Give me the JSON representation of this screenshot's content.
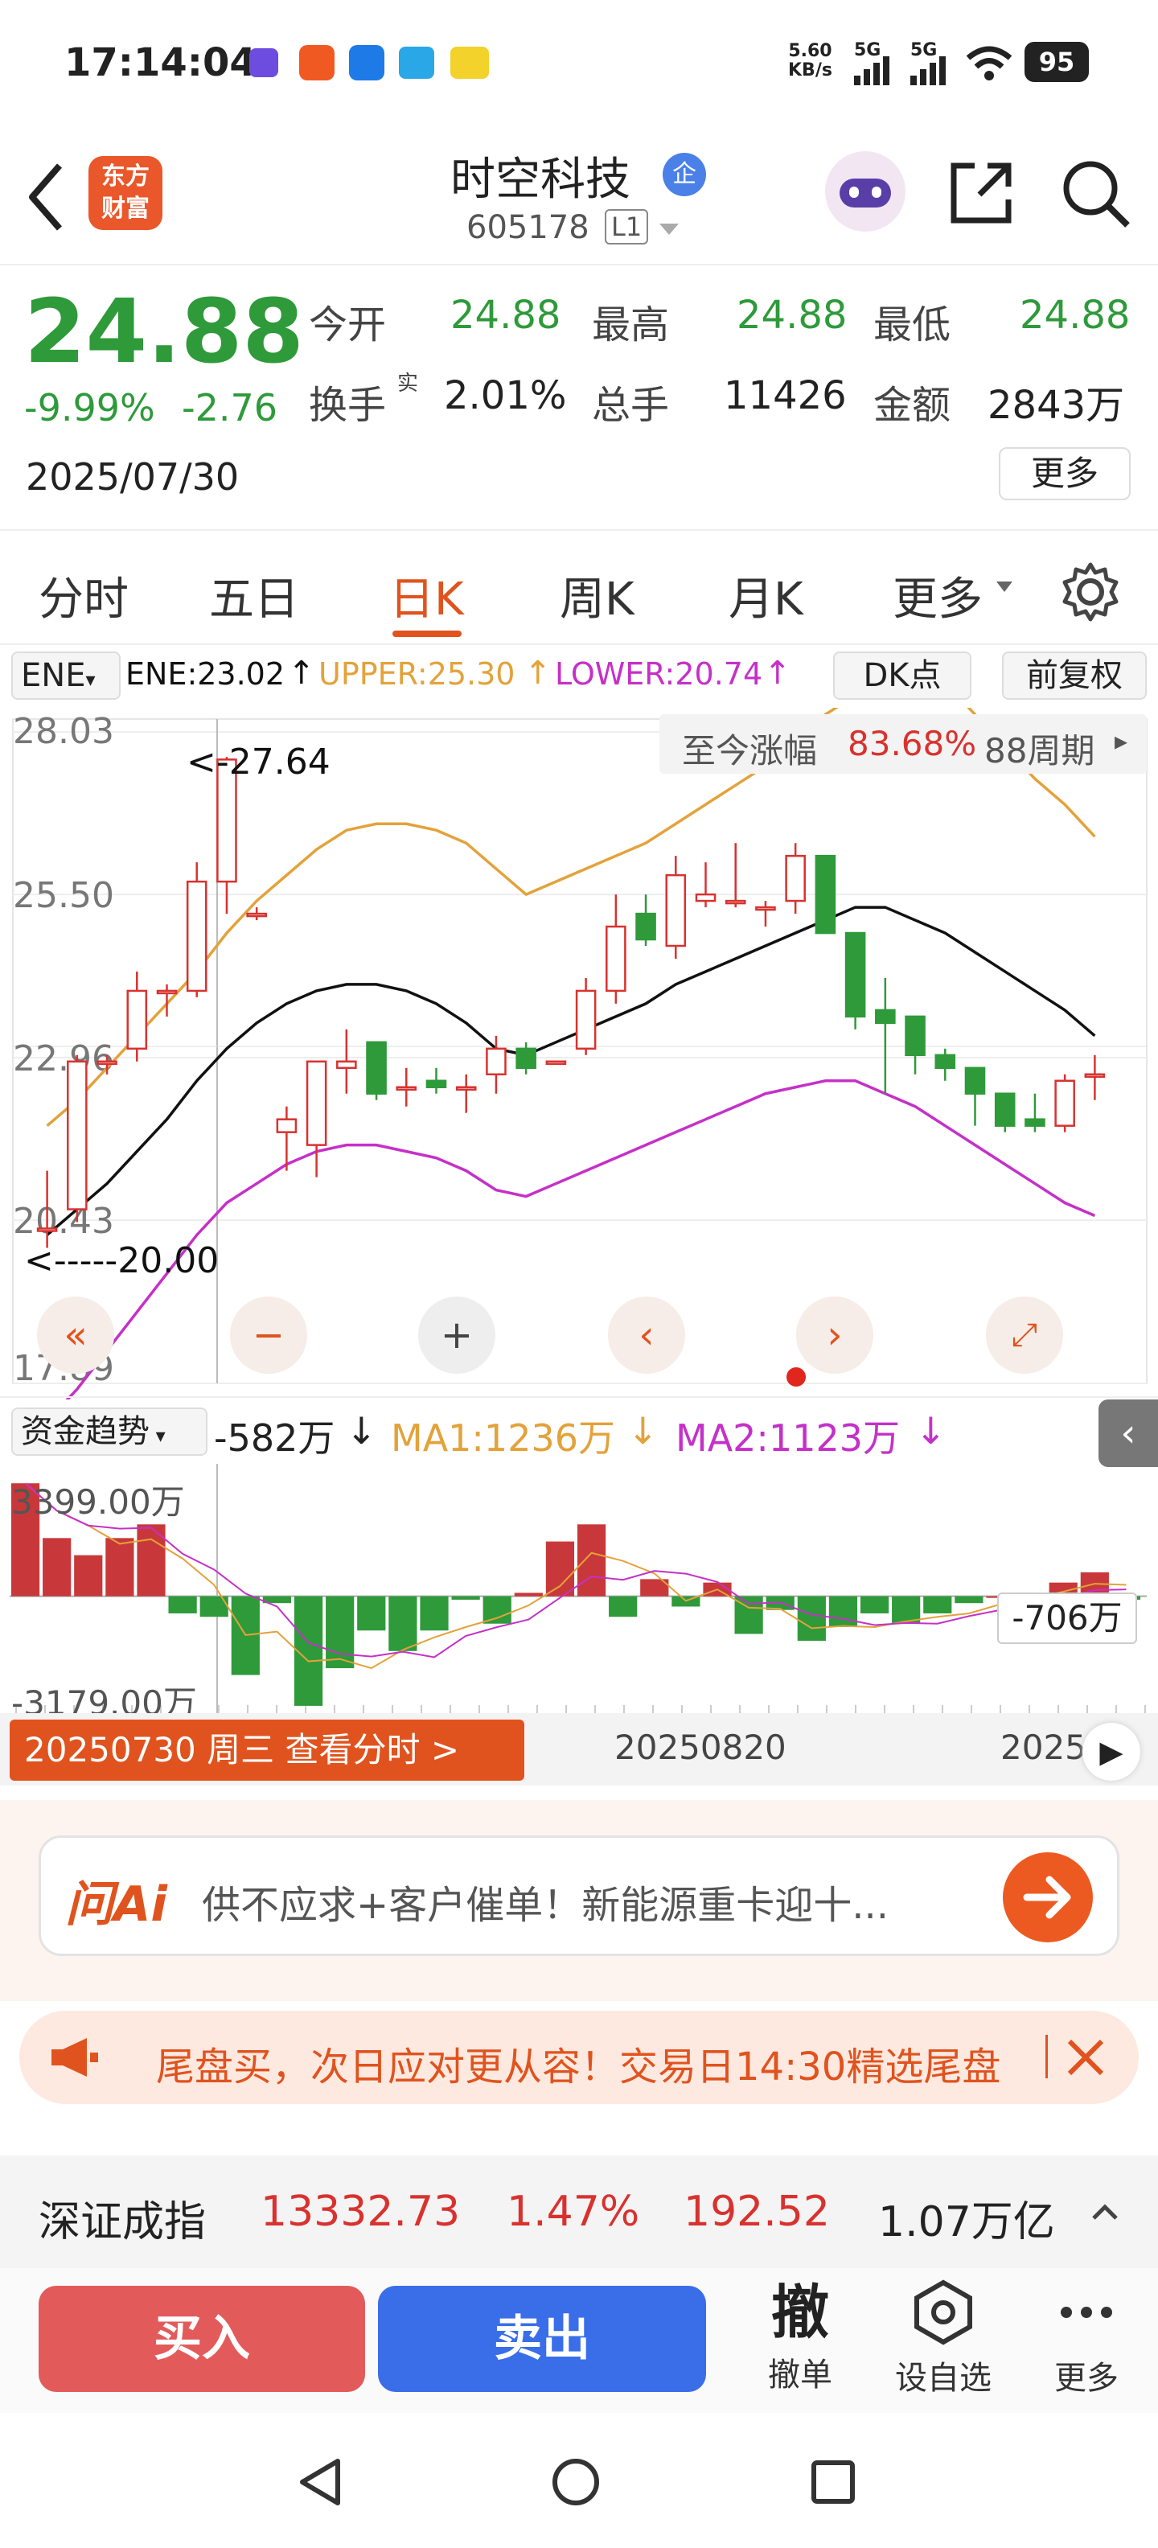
{
  "status": {
    "time": "17:14:04",
    "net_speed_value": "5.60",
    "net_speed_unit": "KB/s",
    "sig1": "5G",
    "sig2": "5G",
    "battery": "95"
  },
  "header": {
    "brand_line1": "东方",
    "brand_line2": "财富",
    "stock_name": "时空科技",
    "badge": "企",
    "code": "605178",
    "level": "L1"
  },
  "quote": {
    "price": "24.88",
    "change_pct": "-9.99%",
    "change": "-2.76",
    "date": "2025/07/30",
    "open_label": "今开",
    "open": "24.88",
    "high_label": "最高",
    "high": "24.88",
    "low_label": "最低",
    "low": "24.88",
    "turnover_label": "换手",
    "turnover_sup": "实",
    "turnover": "2.01%",
    "volume_label": "总手",
    "volume": "11426",
    "amount_label": "金额",
    "amount": "2843万",
    "more": "更多"
  },
  "tabs": [
    "分时",
    "五日",
    "日K",
    "周K",
    "月K",
    "更多"
  ],
  "indicator": {
    "name": "ENE",
    "ene": "ENE:23.02",
    "upper": "UPPER:25.30",
    "lower": "LOWER:20.74",
    "dk": "DK点",
    "fq": "前复权",
    "cum_label": "至今涨幅",
    "cum_value": "83.68%",
    "cum_period": "88周期",
    "annot_high": "<-27.64",
    "annot_low": "<-----20.00"
  },
  "colors": {
    "up": "#d8322f",
    "down": "#2e9a3a",
    "upper": "#e3a23a",
    "lower": "#c530c8",
    "ene": "#111111",
    "accent": "#e0531e"
  },
  "fund": {
    "name": "资金趋势",
    "value": "-582万",
    "ma1": "MA1:1236万",
    "ma2": "MA2:1123万",
    "top": "3399.00万",
    "bottom": "-3179.00万",
    "current": "-706万"
  },
  "timeline": {
    "selected": "20250730 周三 查看分时 >",
    "mid": "20250820",
    "right": "2025"
  },
  "ask": {
    "logo": "问Ai",
    "placeholder": "供不应求+客户催单！新能源重卡迎十..."
  },
  "banner": {
    "text": "尾盘买，次日应对更从容！交易日14:30精选尾盘"
  },
  "index": {
    "name": "深证成指",
    "value": "13332.73",
    "pct": "1.47%",
    "chg": "192.52",
    "amount": "1.07万亿"
  },
  "actions": {
    "buy": "买入",
    "sell": "卖出",
    "cancel_big": "撤",
    "cancel": "撤单",
    "watch": "设自选",
    "more": "更多"
  },
  "chart_data": [
    {
      "type": "candlestick",
      "title": "日K",
      "yticks": [
        28.03,
        25.5,
        22.96,
        20.43,
        17.89
      ],
      "ylim": [
        17.89,
        28.03
      ],
      "candles": [
        {
          "o": 20.3,
          "h": 21.2,
          "l": 20.0,
          "c": 20.3
        },
        {
          "o": 20.6,
          "h": 23.0,
          "l": 20.4,
          "c": 22.9
        },
        {
          "o": 22.9,
          "h": 23.0,
          "l": 22.7,
          "c": 22.9
        },
        {
          "o": 23.1,
          "h": 24.3,
          "l": 22.9,
          "c": 24.0
        },
        {
          "o": 24.0,
          "h": 24.1,
          "l": 23.6,
          "c": 24.0
        },
        {
          "o": 24.0,
          "h": 26.0,
          "l": 23.9,
          "c": 25.7
        },
        {
          "o": 25.7,
          "h": 27.64,
          "l": 25.2,
          "c": 27.6
        },
        {
          "o": 25.2,
          "h": 25.3,
          "l": 25.1,
          "c": 25.2
        },
        {
          "o": 21.8,
          "h": 22.2,
          "l": 21.2,
          "c": 22.0
        },
        {
          "o": 21.6,
          "h": 22.9,
          "l": 21.1,
          "c": 22.9
        },
        {
          "o": 22.8,
          "h": 23.4,
          "l": 22.4,
          "c": 22.9
        },
        {
          "o": 23.2,
          "h": 23.2,
          "l": 22.3,
          "c": 22.4
        },
        {
          "o": 22.5,
          "h": 22.8,
          "l": 22.2,
          "c": 22.5
        },
        {
          "o": 22.6,
          "h": 22.8,
          "l": 22.4,
          "c": 22.5
        },
        {
          "o": 22.5,
          "h": 22.7,
          "l": 22.1,
          "c": 22.5
        },
        {
          "o": 22.7,
          "h": 23.3,
          "l": 22.4,
          "c": 23.1
        },
        {
          "o": 23.1,
          "h": 23.2,
          "l": 22.7,
          "c": 22.8
        },
        {
          "o": 22.9,
          "h": 22.9,
          "l": 22.9,
          "c": 22.9
        },
        {
          "o": 23.1,
          "h": 24.2,
          "l": 23.0,
          "c": 24.0
        },
        {
          "o": 24.0,
          "h": 25.5,
          "l": 23.8,
          "c": 25.0
        },
        {
          "o": 25.2,
          "h": 25.5,
          "l": 24.7,
          "c": 24.8
        },
        {
          "o": 24.7,
          "h": 26.1,
          "l": 24.5,
          "c": 25.8
        },
        {
          "o": 25.4,
          "h": 26.0,
          "l": 25.3,
          "c": 25.5
        },
        {
          "o": 25.4,
          "h": 26.3,
          "l": 25.3,
          "c": 25.4
        },
        {
          "o": 25.3,
          "h": 25.4,
          "l": 25.0,
          "c": 25.3
        },
        {
          "o": 25.4,
          "h": 26.3,
          "l": 25.2,
          "c": 26.1
        },
        {
          "o": 26.1,
          "h": 26.1,
          "l": 24.9,
          "c": 24.9
        },
        {
          "o": 24.9,
          "h": 24.9,
          "l": 23.4,
          "c": 23.6
        },
        {
          "o": 23.7,
          "h": 24.2,
          "l": 22.4,
          "c": 23.5
        },
        {
          "o": 23.6,
          "h": 23.6,
          "l": 22.7,
          "c": 23.0
        },
        {
          "o": 23.0,
          "h": 23.1,
          "l": 22.6,
          "c": 22.8
        },
        {
          "o": 22.8,
          "h": 22.8,
          "l": 21.9,
          "c": 22.4
        },
        {
          "o": 22.4,
          "h": 22.4,
          "l": 21.8,
          "c": 21.9
        },
        {
          "o": 22.0,
          "h": 22.4,
          "l": 21.8,
          "c": 21.9
        },
        {
          "o": 21.9,
          "h": 22.7,
          "l": 21.8,
          "c": 22.6
        },
        {
          "o": 22.7,
          "h": 23.0,
          "l": 22.3,
          "c": 22.7
        }
      ],
      "series": [
        {
          "name": "UPPER",
          "values": [
            21.9,
            22.3,
            22.8,
            23.3,
            23.8,
            24.3,
            24.9,
            25.4,
            25.8,
            26.2,
            26.5,
            26.6,
            26.6,
            26.5,
            26.3,
            25.9,
            25.5,
            25.7,
            25.9,
            26.1,
            26.3,
            26.6,
            26.9,
            27.2,
            27.5,
            27.9,
            28.3,
            28.6,
            28.9,
            29.0,
            28.8,
            28.3,
            27.8,
            27.3,
            26.9,
            26.4
          ]
        },
        {
          "name": "ENE",
          "values": [
            20.2,
            20.6,
            21.0,
            21.5,
            22.0,
            22.6,
            23.1,
            23.5,
            23.8,
            24.0,
            24.1,
            24.1,
            24.0,
            23.8,
            23.5,
            23.1,
            23.0,
            23.2,
            23.4,
            23.6,
            23.8,
            24.1,
            24.3,
            24.5,
            24.7,
            24.9,
            25.1,
            25.3,
            25.3,
            25.1,
            24.9,
            24.6,
            24.3,
            24.0,
            23.7,
            23.3
          ]
        },
        {
          "name": "LOWER",
          "values": [
            17.3,
            17.8,
            18.4,
            19.0,
            19.6,
            20.2,
            20.7,
            21.0,
            21.3,
            21.5,
            21.6,
            21.6,
            21.5,
            21.4,
            21.2,
            20.9,
            20.8,
            21.0,
            21.2,
            21.4,
            21.6,
            21.8,
            22.0,
            22.2,
            22.4,
            22.5,
            22.6,
            22.6,
            22.4,
            22.2,
            21.9,
            21.6,
            21.3,
            21.0,
            20.7,
            20.5
          ]
        }
      ]
    },
    {
      "type": "bar",
      "title": "资金趋势",
      "ylim": [
        -3179,
        3399
      ],
      "values": [
        3300,
        1700,
        1200,
        1700,
        2100,
        -500,
        -600,
        -2300,
        -200,
        -3200,
        -2100,
        -1000,
        -1600,
        -1000,
        -100,
        -800,
        100,
        1600,
        2100,
        -600,
        500,
        -300,
        400,
        -1100,
        -400,
        -1300,
        -900,
        -500,
        -800,
        -500,
        -200,
        0,
        0,
        400,
        700,
        -100
      ]
    }
  ]
}
